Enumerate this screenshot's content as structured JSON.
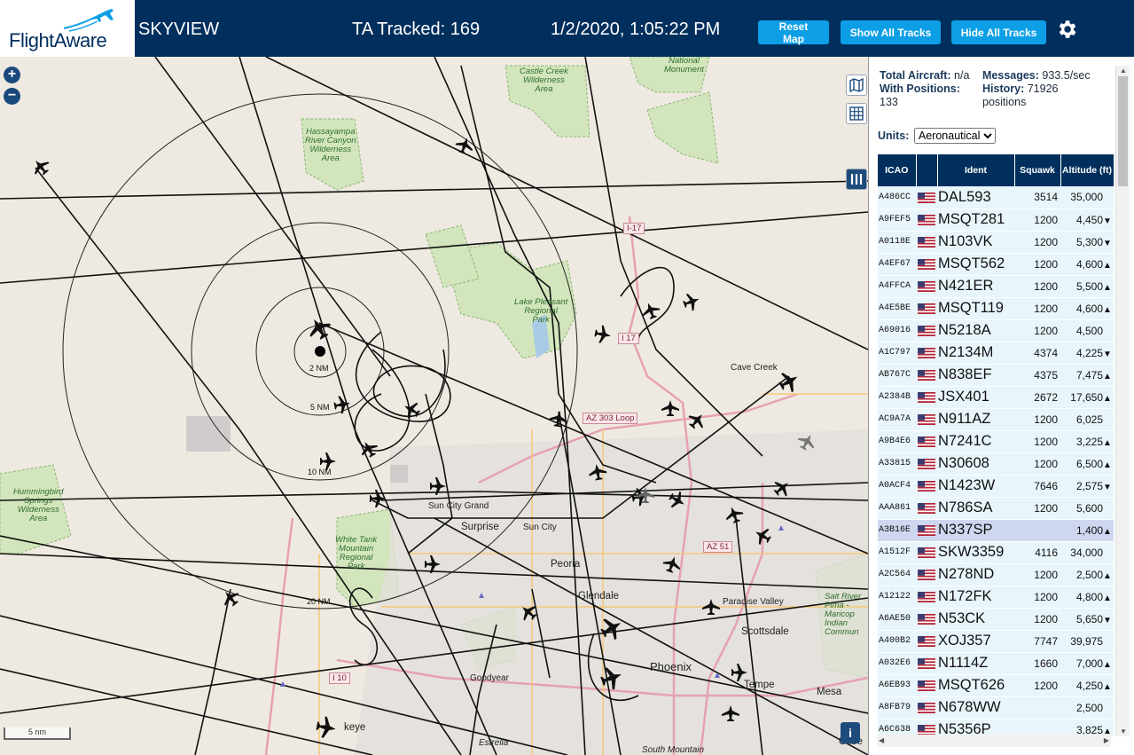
{
  "header": {
    "logo_text": "FlightAware",
    "app_name": "SKYVIEW",
    "tracked": "TA Tracked: 169",
    "clock": "1/2/2020, 1:05:22 PM",
    "btn_reset": "Reset Map",
    "btn_show": "Show All Tracks",
    "btn_hide": "Hide All Tracks",
    "settings_icon": "gear-icon"
  },
  "map": {
    "zoom_in": "+",
    "zoom_out": "−",
    "scale_label": "5 nm",
    "layers_icon": "map-icon",
    "grid_icon": "grid-icon",
    "columns_icon": "columns-icon",
    "info_label": "i",
    "ring_labels": [
      "2 NM",
      "5 NM",
      "10 NM",
      "20 NM"
    ],
    "park_labels": [
      "National\nMonument",
      "Castle Creek\nWilderness\nArea",
      "Hassayampa\nRiver Canyon\nWilderness\nArea",
      "Lake Pleasant\nRegional\nPark",
      "Hummingbird\nSprings\nWilderness\nArea",
      "White Tank\nMountain\nRegional\nPark",
      "Salt River\nPima -\nMaricop\nIndian\nCommun"
    ],
    "city_labels": [
      "Cave Creek",
      "Sun City Grand",
      "Surprise",
      "Sun City",
      "Peoria",
      "Glendale",
      "Paradise Valley",
      "Scottsdale",
      "Phoenix",
      "Goodyear",
      "Tempe",
      "Mesa",
      "Estrella",
      "South Mountain",
      "Gilbe",
      "keye"
    ],
    "road_labels": [
      "I-17",
      "I 17",
      "AZ 303 Loop",
      "AZ 51",
      "I 10"
    ]
  },
  "sidebar": {
    "total_aircraft_label": "Total Aircraft:",
    "total_aircraft_value": "n/a",
    "with_positions_label": "With Positions:",
    "with_positions_value": "133",
    "messages_label": "Messages:",
    "messages_value": "933.5/sec",
    "history_label": "History:",
    "history_value": "71926 positions",
    "units_label": "Units:",
    "units_value": "Aeronautical",
    "columns": [
      "ICAO",
      "",
      "Ident",
      "Squawk",
      "Altitude (ft)"
    ],
    "rows": [
      {
        "icao": "A486CC",
        "ident": "DAL593",
        "squawk": "3514",
        "alt": "35,000",
        "trend": ""
      },
      {
        "icao": "A9FEF5",
        "ident": "MSQT281",
        "squawk": "1200",
        "alt": "4,450",
        "trend": "▼"
      },
      {
        "icao": "A0118E",
        "ident": "N103VK",
        "squawk": "1200",
        "alt": "5,300",
        "trend": "▼"
      },
      {
        "icao": "A4EF67",
        "ident": "MSQT562",
        "squawk": "1200",
        "alt": "4,600",
        "trend": "▲"
      },
      {
        "icao": "A4FFCA",
        "ident": "N421ER",
        "squawk": "1200",
        "alt": "5,500",
        "trend": "▲"
      },
      {
        "icao": "A4E5BE",
        "ident": "MSQT119",
        "squawk": "1200",
        "alt": "4,600",
        "trend": "▲"
      },
      {
        "icao": "A69016",
        "ident": "N5218A",
        "squawk": "1200",
        "alt": "4,500",
        "trend": ""
      },
      {
        "icao": "A1C797",
        "ident": "N2134M",
        "squawk": "4374",
        "alt": "4,225",
        "trend": "▼"
      },
      {
        "icao": "AB767C",
        "ident": "N838EF",
        "squawk": "4375",
        "alt": "7,475",
        "trend": "▲"
      },
      {
        "icao": "A2384B",
        "ident": "JSX401",
        "squawk": "2672",
        "alt": "17,650",
        "trend": "▲"
      },
      {
        "icao": "AC9A7A",
        "ident": "N911AZ",
        "squawk": "1200",
        "alt": "6,025",
        "trend": ""
      },
      {
        "icao": "A9B4E6",
        "ident": "N7241C",
        "squawk": "1200",
        "alt": "3,225",
        "trend": "▲"
      },
      {
        "icao": "A33815",
        "ident": "N30608",
        "squawk": "1200",
        "alt": "6,500",
        "trend": "▲"
      },
      {
        "icao": "A0ACF4",
        "ident": "N1423W",
        "squawk": "7646",
        "alt": "2,575",
        "trend": "▼"
      },
      {
        "icao": "AAA861",
        "ident": "N786SA",
        "squawk": "1200",
        "alt": "5,600",
        "trend": ""
      },
      {
        "icao": "A3B16E",
        "ident": "N337SP",
        "squawk": "",
        "alt": "1,400",
        "trend": "▲"
      },
      {
        "icao": "A1512F",
        "ident": "SKW3359",
        "squawk": "4116",
        "alt": "34,000",
        "trend": ""
      },
      {
        "icao": "A2C564",
        "ident": "N278ND",
        "squawk": "1200",
        "alt": "2,500",
        "trend": "▲"
      },
      {
        "icao": "A12122",
        "ident": "N172FK",
        "squawk": "1200",
        "alt": "4,800",
        "trend": "▲"
      },
      {
        "icao": "A6AE50",
        "ident": "N53CK",
        "squawk": "1200",
        "alt": "5,650",
        "trend": "▼"
      },
      {
        "icao": "A400B2",
        "ident": "XOJ357",
        "squawk": "7747",
        "alt": "39,975",
        "trend": ""
      },
      {
        "icao": "A032E6",
        "ident": "N1114Z",
        "squawk": "1660",
        "alt": "7,000",
        "trend": "▲"
      },
      {
        "icao": "A6EB93",
        "ident": "MSQT626",
        "squawk": "1200",
        "alt": "4,250",
        "trend": "▲"
      },
      {
        "icao": "A8FB79",
        "ident": "N678WW",
        "squawk": "",
        "alt": "2,500",
        "trend": ""
      },
      {
        "icao": "A6C638",
        "ident": "N5356P",
        "squawk": "",
        "alt": "3,825",
        "trend": "▲"
      }
    ],
    "selected_row": 15
  },
  "colors": {
    "header_bg": "#002f5d",
    "button_bg": "#0d9fe6",
    "row_bg": "#e8f5fb",
    "row_selected_bg": "#cfd7f0"
  }
}
